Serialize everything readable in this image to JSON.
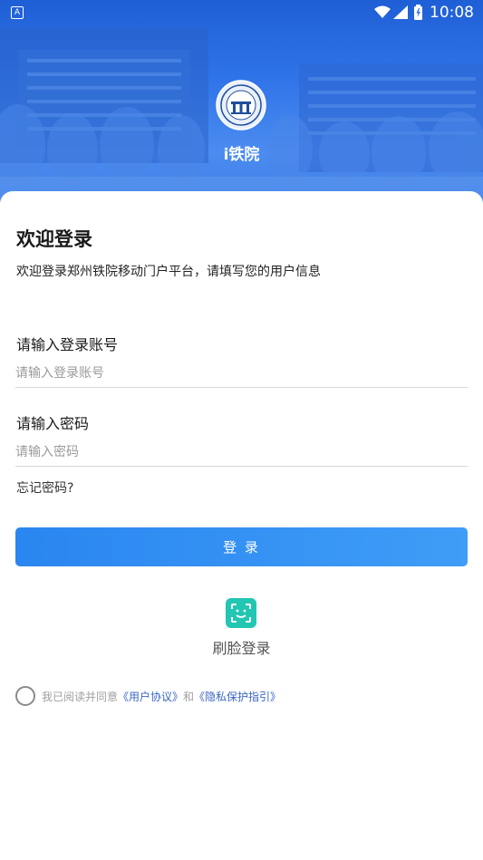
{
  "status_bar": {
    "indicator": "A",
    "time": "10:08"
  },
  "header": {
    "app_name": "i铁院",
    "logo": "school-emblem"
  },
  "login": {
    "title": "欢迎登录",
    "subtitle": "欢迎登录郑州铁院移动门户平台，请填写您的用户信息",
    "account_label": "请输入登录账号",
    "account_placeholder": "请输入登录账号",
    "account_value": "",
    "password_label": "请输入密码",
    "password_placeholder": "请输入密码",
    "password_value": "",
    "forgot": "忘记密码?",
    "submit": "登 录"
  },
  "face_login": {
    "label": "刷脸登录",
    "icon": "face-scan-icon"
  },
  "agreement": {
    "prefix": "我已阅读并同意",
    "user_agreement": "《用户协议》",
    "and": "和",
    "privacy": "《隐私保护指引》",
    "checked": false
  },
  "colors": {
    "accent": "#2f86f0",
    "face_icon": "#22c6b3",
    "link": "#3a66c4"
  }
}
